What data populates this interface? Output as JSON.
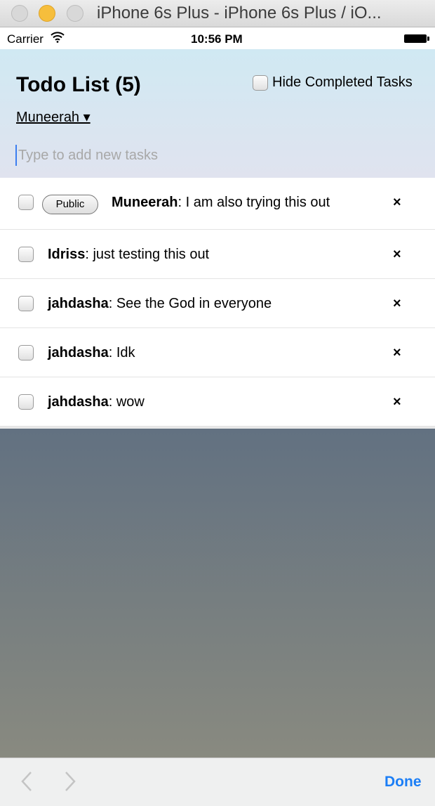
{
  "window": {
    "title": "iPhone 6s Plus - iPhone 6s Plus / iO..."
  },
  "status": {
    "carrier": "Carrier",
    "time": "10:56 PM"
  },
  "header": {
    "title": "Todo List (5)",
    "hide_completed_label": "Hide Completed Tasks",
    "user_select": "Muneerah ▾",
    "new_task_placeholder": "Type to add new tasks"
  },
  "tasks": [
    {
      "user": "Muneerah",
      "text": ": I am also trying this out",
      "badge": "Public",
      "delete": "×"
    },
    {
      "user": "Idriss",
      "text": ": just testing this out",
      "delete": "×"
    },
    {
      "user": "jahdasha",
      "text": ": See the God in everyone",
      "delete": "×"
    },
    {
      "user": "jahdasha",
      "text": ": Idk",
      "delete": "×"
    },
    {
      "user": "jahdasha",
      "text": ": wow",
      "delete": "×"
    }
  ],
  "toolbar": {
    "done_label": "Done"
  },
  "icons": {
    "prev": "chevron-left-icon",
    "next": "chevron-right-icon",
    "wifi": "wifi-icon",
    "battery": "battery-icon"
  },
  "colors": {
    "accent": "#1b7ef6",
    "header_top": "#d0e9f3",
    "header_bottom": "#e0e3ef"
  }
}
